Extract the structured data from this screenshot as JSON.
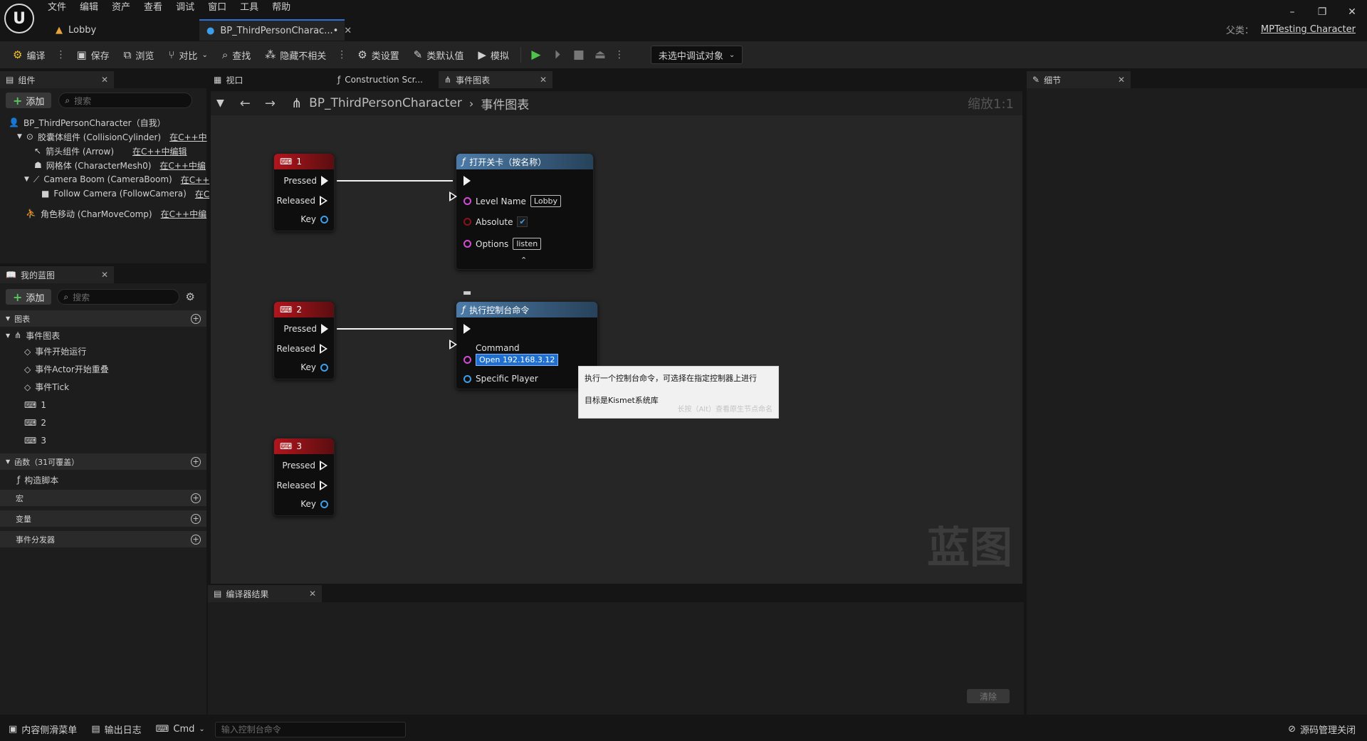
{
  "menu": [
    "文件",
    "编辑",
    "资产",
    "查看",
    "调试",
    "窗口",
    "工具",
    "帮助"
  ],
  "tabs": {
    "lobby": "Lobby",
    "bp": "BP_ThirdPersonCharac...•"
  },
  "parent": {
    "label": "父类：",
    "value": "MPTesting Character"
  },
  "toolbar": {
    "compile": "编译",
    "save": "保存",
    "browse": "浏览",
    "diff": "对比",
    "find": "查找",
    "hide_unrelated": "隐藏不相关",
    "class_settings": "类设置",
    "class_defaults": "类默认值",
    "simulate": "模拟",
    "debug_object": "未选中调试对象"
  },
  "components_panel": {
    "title": "组件",
    "add": "添加",
    "search_placeholder": "搜索",
    "root": "BP_ThirdPersonCharacter（自我）",
    "items": [
      {
        "label": "胶囊体组件 (CollisionCylinder)",
        "link": "在C++中"
      },
      {
        "label": "箭头组件 (Arrow)",
        "link": "在C++中编辑"
      },
      {
        "label": "网格体 (CharacterMesh0)",
        "link": "在C++中编"
      },
      {
        "label": "Camera Boom (CameraBoom)",
        "link": "在C++"
      },
      {
        "label": "Follow Camera (FollowCamera)",
        "link": "在C"
      },
      {
        "label": "角色移动 (CharMoveComp)",
        "link": "在C++中编"
      }
    ]
  },
  "my_blueprint": {
    "title": "我的蓝图",
    "add": "添加",
    "search_placeholder": "搜索",
    "graphs_header": "图表",
    "event_graph": "事件图表",
    "events": [
      "事件开始运行",
      "事件Actor开始重叠",
      "事件Tick",
      "1",
      "2",
      "3"
    ],
    "functions_header": "函数（31可覆盖）",
    "construction": "构造脚本",
    "macros_header": "宏",
    "variables_header": "变量",
    "dispatchers_header": "事件分发器"
  },
  "graph_tabs": {
    "viewport": "视口",
    "construction": "Construction Scr...",
    "event_graph": "事件图表"
  },
  "breadcrumb": {
    "class": "BP_ThirdPersonCharacter",
    "graph": "事件图表",
    "zoom": "缩放1:1"
  },
  "nodes": {
    "key1": {
      "title": "1",
      "pressed": "Pressed",
      "released": "Released",
      "key": "Key"
    },
    "key2": {
      "title": "2",
      "pressed": "Pressed",
      "released": "Released",
      "key": "Key"
    },
    "key3": {
      "title": "3",
      "pressed": "Pressed",
      "released": "Released",
      "key": "Key"
    },
    "open_level": {
      "title": "打开关卡（按名称）",
      "level_name_label": "Level Name",
      "level_name_value": "Lobby",
      "absolute_label": "Absolute",
      "options_label": "Options",
      "options_value": "listen"
    },
    "console_cmd": {
      "title": "执行控制台命令",
      "command_label": "Command",
      "command_value": "Open 192.168.3.12",
      "player_label": "Specific Player"
    }
  },
  "tooltip": {
    "line1": "执行一个控制台命令，可选择在指定控制器上进行",
    "line2": "目标是Kismet系统库",
    "hint": "长按（Alt）查看原生节点命名"
  },
  "watermark": "蓝图",
  "details_panel": {
    "title": "细节"
  },
  "compiler": {
    "title": "编译器结果",
    "clear": "清除"
  },
  "statusbar": {
    "content_drawer": "内容侧滑菜单",
    "output_log": "输出日志",
    "cmd": "Cmd",
    "console_placeholder": "输入控制台命令",
    "source_control": "源码管理关闭"
  }
}
